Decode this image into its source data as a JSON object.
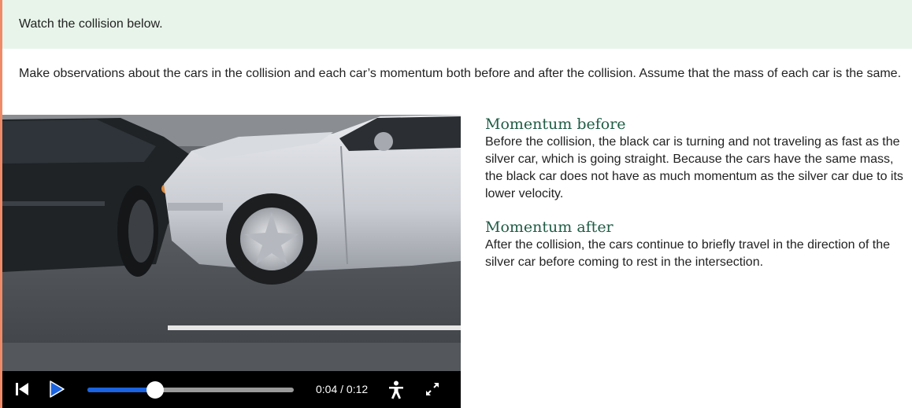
{
  "banner": {
    "text": "Watch the collision below."
  },
  "instructions": {
    "text": "Make observations about the cars in the collision and each car’s momentum both before and after the collision. Assume that the mass of each car is the same."
  },
  "video": {
    "current_time": "0:04",
    "duration": "0:12",
    "timecode": "0:04 / 0:12",
    "progress": 0.33,
    "accent_color": "#1b63e0"
  },
  "panel": {
    "before": {
      "title": "Momentum before",
      "body": "Before the collision, the black car is turning and not traveling as fast as the silver car, which is going straight. Because the cars have the same mass, the black car does not have as much momentum as the silver car due to its lower velocity."
    },
    "after": {
      "title": "Momentum after",
      "body": "After the collision, the cars continue to briefly travel in the direction of the silver car before coming to rest in the intersection."
    }
  },
  "colors": {
    "banner_bg": "#e8f4ea",
    "heading": "#1f5c46",
    "accent_bar": "#f08a66"
  }
}
